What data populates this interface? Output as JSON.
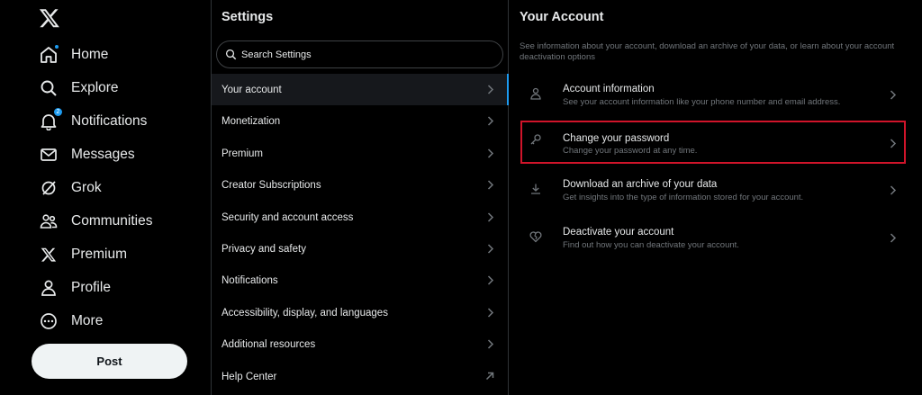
{
  "nav": {
    "items": [
      {
        "label": "Home",
        "icon": "home-icon"
      },
      {
        "label": "Explore",
        "icon": "search-icon"
      },
      {
        "label": "Notifications",
        "icon": "bell-icon",
        "badge": "2"
      },
      {
        "label": "Messages",
        "icon": "envelope-icon"
      },
      {
        "label": "Grok",
        "icon": "grok-icon"
      },
      {
        "label": "Communities",
        "icon": "people-icon"
      },
      {
        "label": "Premium",
        "icon": "x-logo-icon"
      },
      {
        "label": "Profile",
        "icon": "person-icon"
      },
      {
        "label": "More",
        "icon": "more-circle-icon"
      }
    ],
    "post_label": "Post"
  },
  "settings": {
    "title": "Settings",
    "search_placeholder": "Search Settings",
    "items": [
      {
        "label": "Your account"
      },
      {
        "label": "Monetization"
      },
      {
        "label": "Premium"
      },
      {
        "label": "Creator Subscriptions"
      },
      {
        "label": "Security and account access"
      },
      {
        "label": "Privacy and safety"
      },
      {
        "label": "Notifications"
      },
      {
        "label": "Accessibility, display, and languages"
      },
      {
        "label": "Additional resources"
      },
      {
        "label": "Help Center"
      }
    ]
  },
  "account": {
    "title": "Your Account",
    "description": "See information about your account, download an archive of your data, or learn about your account deactivation options",
    "items": [
      {
        "title": "Account information",
        "subtitle": "See your account information like your phone number and email address."
      },
      {
        "title": "Change your password",
        "subtitle": "Change your password at any time."
      },
      {
        "title": "Download an archive of your data",
        "subtitle": "Get insights into the type of information stored for your account."
      },
      {
        "title": "Deactivate your account",
        "subtitle": "Find out how you can deactivate your account."
      }
    ]
  },
  "colors": {
    "accent": "#1d9bf0",
    "highlight": "#d0142a",
    "muted": "#71767b"
  }
}
